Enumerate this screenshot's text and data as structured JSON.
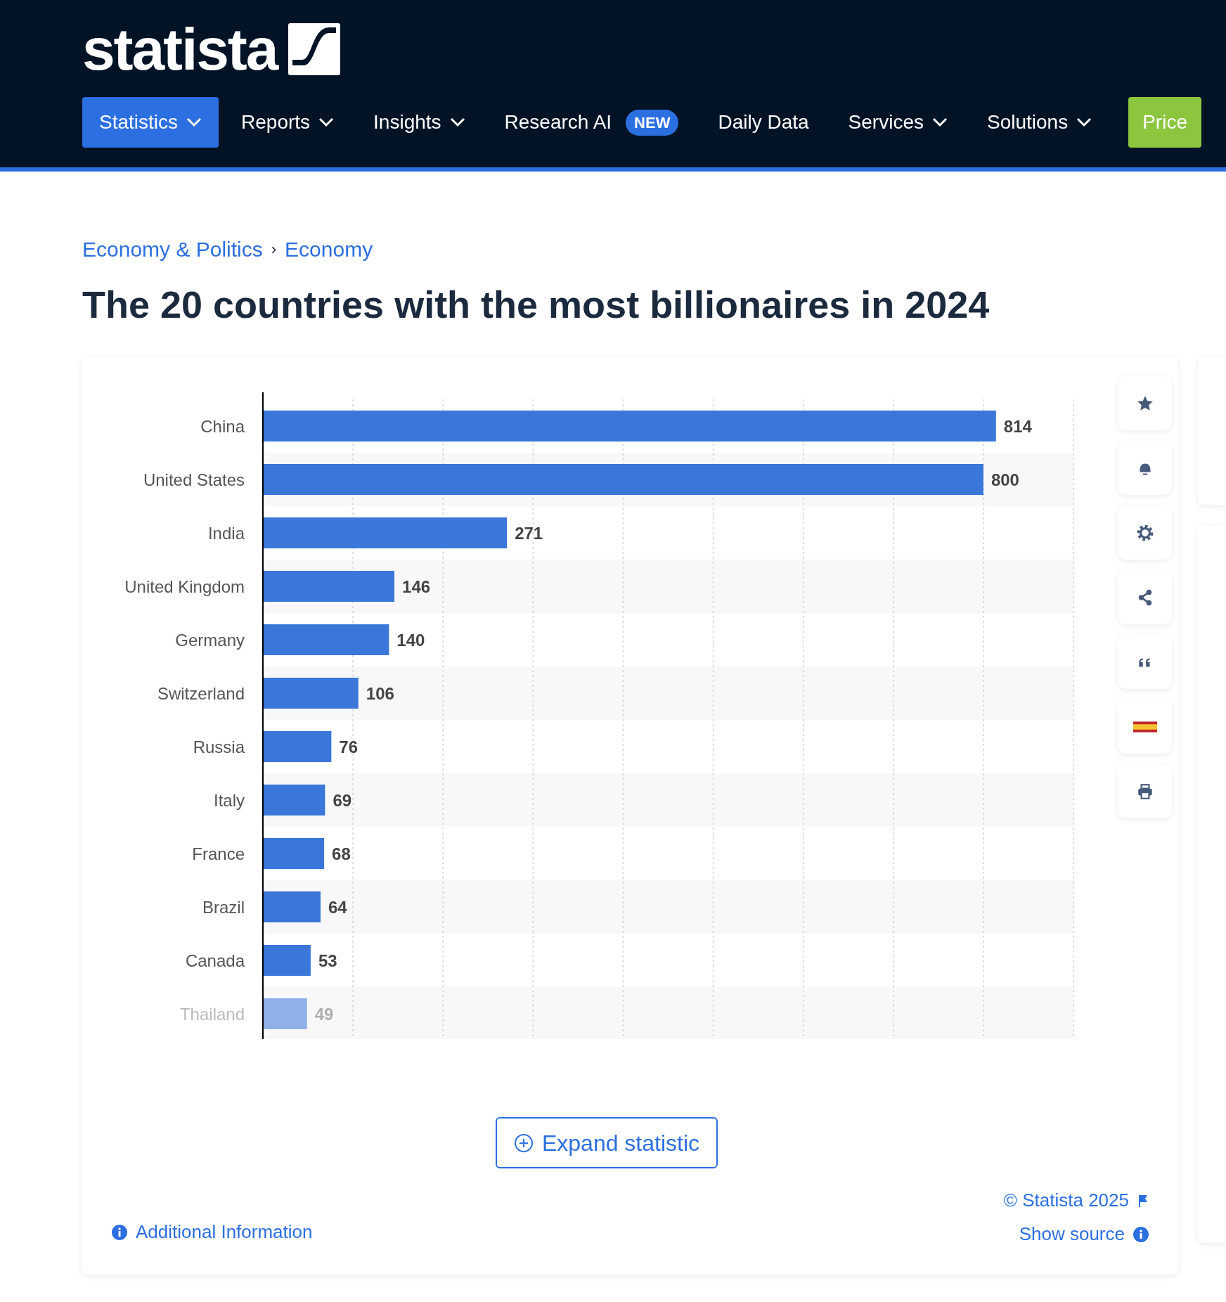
{
  "logo": {
    "text": "statista"
  },
  "nav": [
    {
      "label": "Statistics",
      "selected": true,
      "kind": "dropdown"
    },
    {
      "label": "Reports",
      "selected": false,
      "kind": "dropdown"
    },
    {
      "label": "Insights",
      "selected": false,
      "kind": "dropdown"
    },
    {
      "label": "Research AI",
      "selected": false,
      "kind": "badge",
      "badge": "NEW"
    },
    {
      "label": "Daily Data",
      "selected": false,
      "kind": "plain"
    },
    {
      "label": "Services",
      "selected": false,
      "kind": "dropdown"
    },
    {
      "label": "Solutions",
      "selected": false,
      "kind": "dropdown"
    },
    {
      "label": "Price",
      "selected": false,
      "kind": "cta"
    }
  ],
  "breadcrumb": [
    "Economy & Politics",
    "Economy"
  ],
  "breadcrumb_separator": "›",
  "title": "The 20 countries with the most billionaires in 2024",
  "chart": {
    "chart_data": {
      "type": "bar",
      "orientation": "horizontal",
      "data_labels": true,
      "categories": [
        "China",
        "United States",
        "India",
        "United Kingdom",
        "Germany",
        "Switzerland",
        "Russia",
        "Italy",
        "France",
        "Brazil",
        "Canada",
        "Thailand"
      ],
      "values": [
        814,
        800,
        271,
        146,
        140,
        106,
        76,
        69,
        68,
        64,
        53,
        49
      ],
      "xlim": [
        0,
        900
      ]
    }
  },
  "toolbar": [
    {
      "kind": "star"
    },
    {
      "kind": "bell"
    },
    {
      "kind": "gear"
    },
    {
      "kind": "share"
    },
    {
      "kind": "quote"
    },
    {
      "kind": "flag"
    },
    {
      "kind": "print"
    }
  ],
  "expand_button": "Expand statistic",
  "additional_info": "Additional Information",
  "copyright": "© Statista 2025",
  "show_source": "Show source"
}
